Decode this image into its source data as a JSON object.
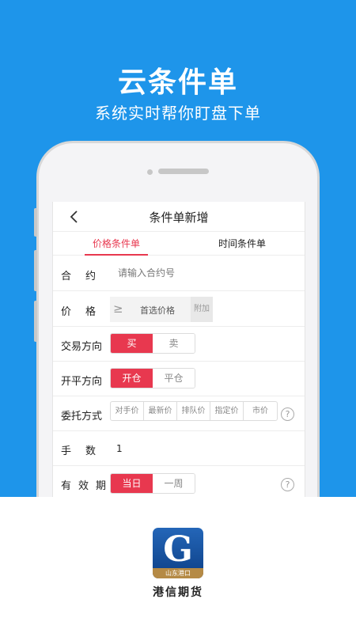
{
  "promo": {
    "headline": "云条件单",
    "subheadline": "系统实时帮你盯盘下单"
  },
  "screen": {
    "title": "条件单新增",
    "back_icon": "chevron-left-icon",
    "tabs": [
      {
        "label": "价格条件单",
        "active": true
      },
      {
        "label": "时间条件单",
        "active": false
      }
    ],
    "form": {
      "contract": {
        "label": "合约",
        "placeholder": "请输入合约号"
      },
      "price": {
        "label": "价格",
        "operator": "≥",
        "placeholder": "首选价格",
        "addon": "附加"
      },
      "direction": {
        "label": "交易方向",
        "options": [
          "买",
          "卖"
        ],
        "selected": "买"
      },
      "open_close": {
        "label": "开平方向",
        "options": [
          "开仓",
          "平仓"
        ],
        "selected": "开仓"
      },
      "order_type": {
        "label": "委托方式",
        "options": [
          "对手价",
          "最新价",
          "排队价",
          "指定价",
          "市价"
        ]
      },
      "quantity": {
        "label": "手数",
        "value": "1"
      },
      "validity": {
        "label": "有效期",
        "options": [
          "当日",
          "一周"
        ],
        "selected": "当日"
      }
    }
  },
  "brand": {
    "logo_letter": "G",
    "logo_badge": "山东港口",
    "name": "港信期货"
  },
  "colors": {
    "background": "#1E95EA",
    "accent": "#E8384F"
  }
}
